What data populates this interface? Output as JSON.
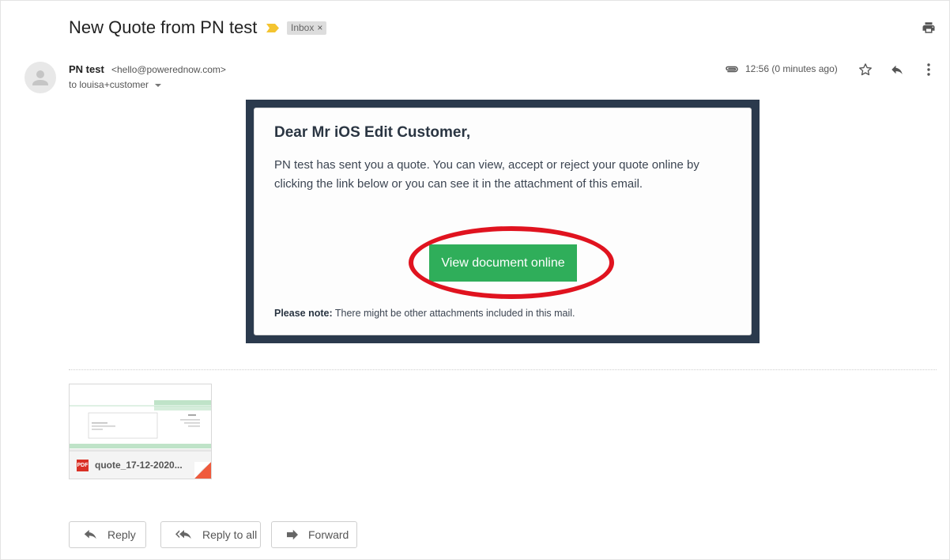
{
  "subject": "New Quote from PN test",
  "label": {
    "text": "Inbox",
    "remove": "×"
  },
  "sender": {
    "name": "PN test",
    "email": "<hello@powerednow.com>"
  },
  "recipients": "to louisa+customer",
  "timestamp": "12:56 (0 minutes ago)",
  "email_body": {
    "greeting": "Dear Mr iOS Edit Customer,",
    "message": "PN test has sent you a quote. You can view, accept or reject your quote online by clicking the link below or you can see it in the attachment of this email.",
    "cta_label": "View document online",
    "note_bold": "Please note:",
    "note_text": "There might be other attachments included in this mail."
  },
  "attachment": {
    "type": "PDF",
    "filename": "quote_17-12-2020..."
  },
  "actions": {
    "reply": "Reply",
    "reply_all": "Reply to all",
    "forward": "Forward"
  },
  "colors": {
    "email_frame": "#2b3a4d",
    "cta": "#2fae5a",
    "highlight_circle": "#e0131f",
    "importance_marker": "#f4c430",
    "pdf_badge": "#d93025"
  },
  "icons": [
    "importance-marker-icon",
    "print-icon",
    "avatar-icon",
    "paperclip-icon",
    "star-icon",
    "reply-icon",
    "more-vert-icon",
    "pdf-icon",
    "reply-all-icon",
    "forward-icon"
  ]
}
